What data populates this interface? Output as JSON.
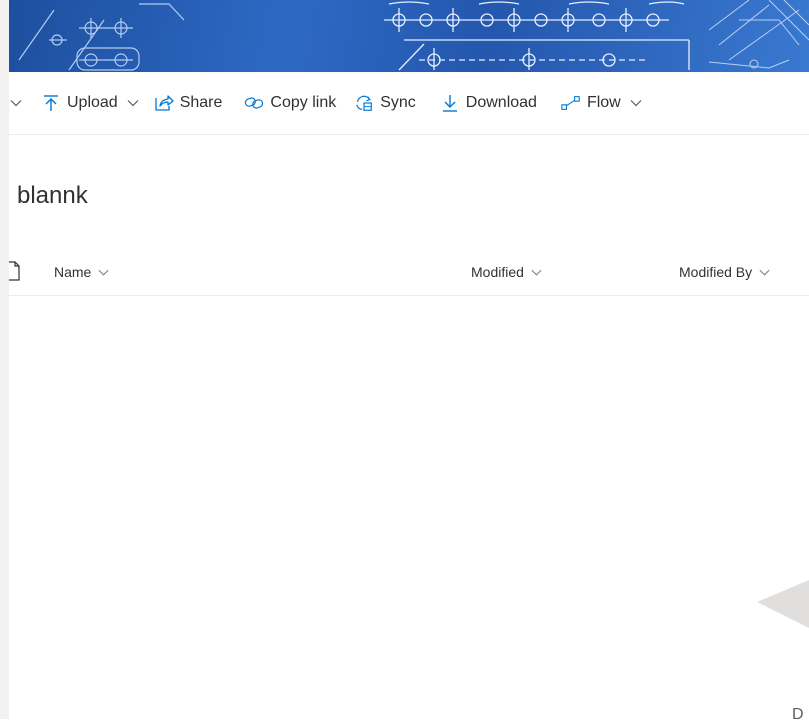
{
  "toolbar": {
    "upload_label": "Upload",
    "share_label": "Share",
    "copy_link_label": "Copy link",
    "sync_label": "Sync",
    "download_label": "Download",
    "flow_label": "Flow",
    "accent_color": "#0078d4"
  },
  "library": {
    "title": "blannk"
  },
  "columns": {
    "name": "Name",
    "modified": "Modified",
    "modified_by": "Modified By"
  },
  "icons": [
    "chevron-down-icon",
    "upload-icon",
    "share-icon",
    "link-icon",
    "sync-icon",
    "download-icon",
    "flow-icon",
    "file-icon"
  ],
  "corner": {
    "text": "D"
  }
}
